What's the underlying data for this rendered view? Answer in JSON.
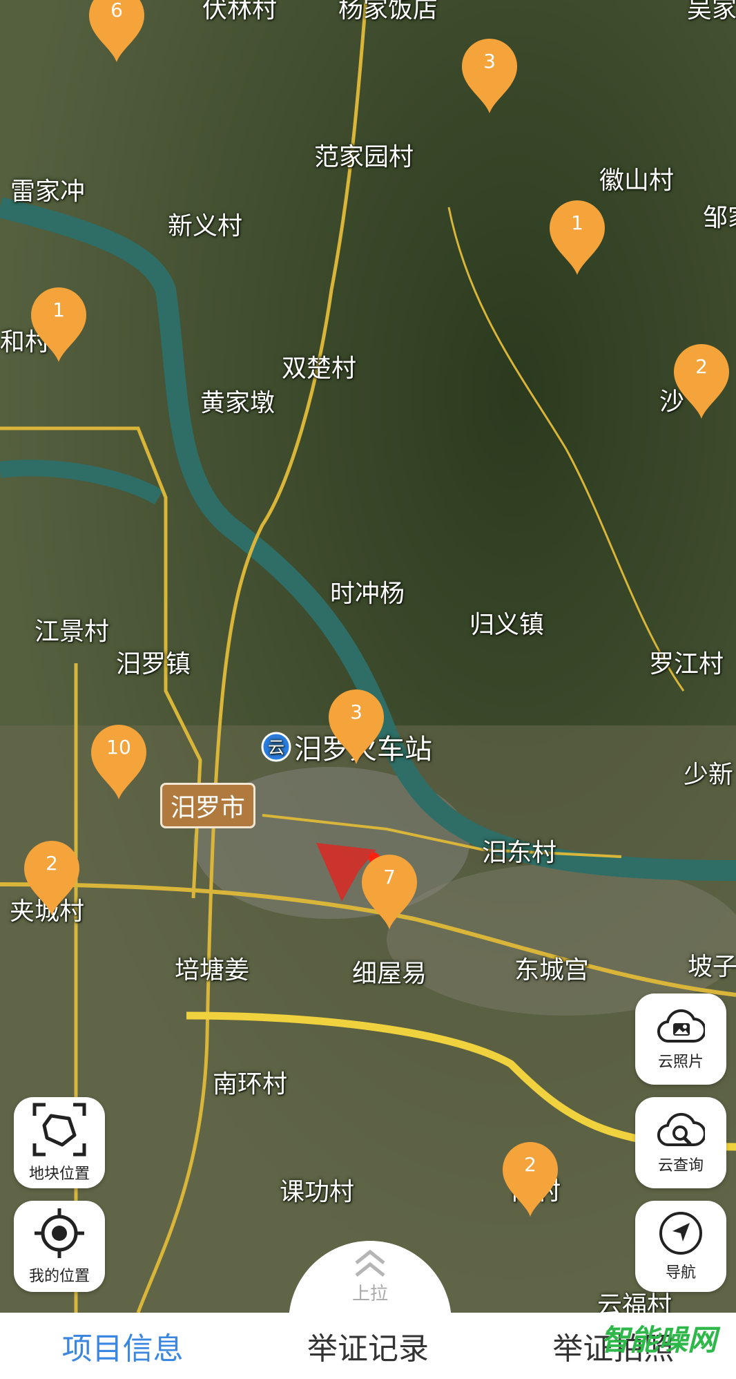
{
  "colors": {
    "pin": "#f5a33b",
    "tab_active": "#3a86e0",
    "tab_inactive": "#333333",
    "city_label_bg": "#b07a3e",
    "watermark": "#2fb84a"
  },
  "map": {
    "places": [
      "伏林村",
      "杨家饭店",
      "吴家",
      "范家园村",
      "徽山村",
      "邹家",
      "雷家冲",
      "新义村",
      "和村",
      "双楚村",
      "黄家墩",
      "沙",
      "时冲杨",
      "归义镇",
      "江景村",
      "汨罗镇",
      "罗江村",
      "少新",
      "汨东村",
      "夹城村",
      "培塘姜",
      "细屋易",
      "东城宫",
      "坡子",
      "南环村",
      "课功村",
      "云福村",
      "南村"
    ],
    "station": "汨罗火车站",
    "station_icon": "train-station-icon",
    "city": "汨罗市",
    "pins": [
      "6",
      "3",
      "1",
      "1",
      "2",
      "3",
      "10",
      "2",
      "7",
      "2"
    ]
  },
  "controls": {
    "cloud_photo": {
      "label": "云照片",
      "icon": "cloud-image-icon"
    },
    "cloud_query": {
      "label": "云查询",
      "icon": "cloud-search-icon"
    },
    "navigate": {
      "label": "导航",
      "icon": "navigation-arrow-icon"
    },
    "plot_location": {
      "label": "地块位置",
      "icon": "plot-boundary-icon"
    },
    "my_location": {
      "label": "我的位置",
      "icon": "locate-crosshair-icon"
    }
  },
  "pull_up": {
    "label": "上拉",
    "icon": "double-chevron-up-icon"
  },
  "tabs": [
    "项目信息",
    "举证记录",
    "举证拍照"
  ],
  "active_tab": "项目信息",
  "watermark": "智能噪网"
}
